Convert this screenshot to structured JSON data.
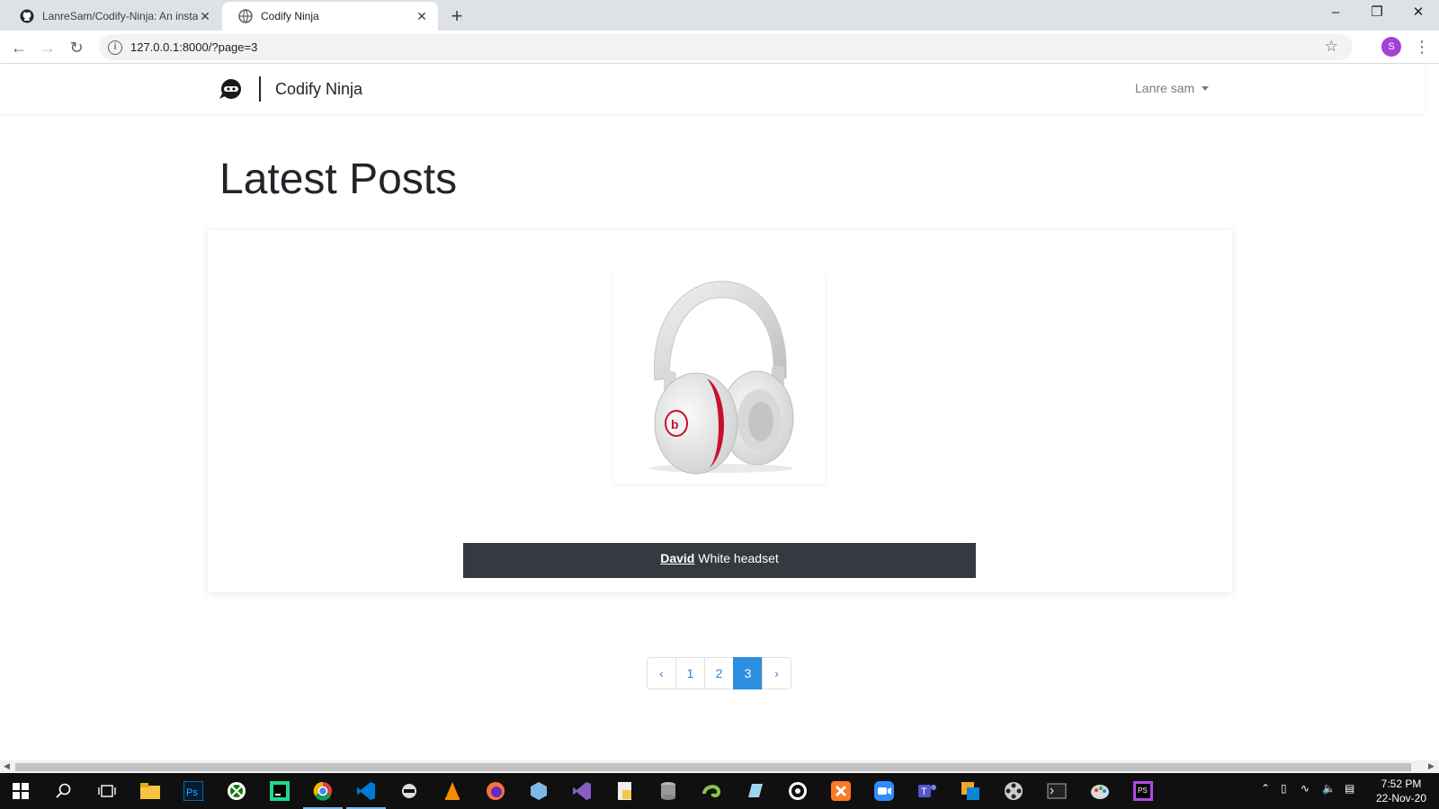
{
  "browser": {
    "tabs": [
      {
        "title": "LanreSam/Codify-Ninja: An insta",
        "active": false,
        "icon": "github-icon"
      },
      {
        "title": "Codify Ninja",
        "active": true,
        "icon": "globe-icon"
      }
    ],
    "url": "127.0.0.1:8000/?page=3",
    "profile_initial": "S"
  },
  "site": {
    "brand": "Codify Ninja",
    "user": "Lanre sam"
  },
  "page": {
    "heading": "Latest Posts"
  },
  "post": {
    "author": "David",
    "title": "White headset",
    "image": "headphones-image"
  },
  "pagination": {
    "prev": "‹",
    "pages": [
      "1",
      "2",
      "3"
    ],
    "active": "3",
    "next": "›"
  },
  "taskbar": {
    "time": "7:52 PM",
    "date": "22-Nov-20"
  },
  "colors": {
    "accent": "#2b8ede",
    "caption_bg": "#343a40",
    "profile": "#a142d5"
  }
}
